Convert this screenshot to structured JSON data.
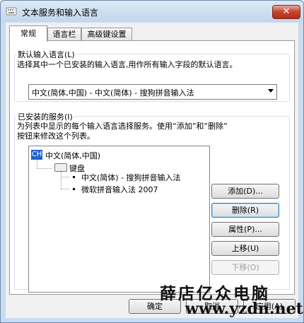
{
  "window": {
    "title": "文本服务和输入语言",
    "close_glyph": "✕"
  },
  "tabs": [
    {
      "label": "常规",
      "active": true
    },
    {
      "label": "语言栏",
      "active": false
    },
    {
      "label": "高级键设置",
      "active": false
    }
  ],
  "default_language": {
    "legend": "默认输入语言(L)",
    "description": "选择其中一个已安装的输入语言,用作所有输入字段的默认语言。",
    "selected": "中文(简体,中国) - 中文(简体) - 搜狗拼音输入法"
  },
  "installed_services": {
    "legend": "已安装的服务(I)",
    "description_line1": "为列表中显示的每个输入语言选择服务。使用“添加”和“删除”",
    "description_line2": "按钮来修改这个列表。",
    "language_badge": "CH",
    "language": "中文(简体,中国)",
    "category": "键盘",
    "items": [
      "中文(简体) - 搜狗拼音输入法",
      "微软拼音输入法 2007"
    ]
  },
  "side_buttons": {
    "add": "添加(D)...",
    "remove": "删除(R)",
    "properties": "属性(P)...",
    "move_up": "上移(U)",
    "move_down": "下移(O)"
  },
  "footer": {
    "ok": "确定",
    "cancel": "取消",
    "apply": "应用(A)"
  },
  "watermark": {
    "text": "薛店亿众电脑",
    "url": "www.yzdn.net"
  },
  "colors": {
    "badge_blue": "#1d64c8",
    "close_red": "#c7402b"
  }
}
